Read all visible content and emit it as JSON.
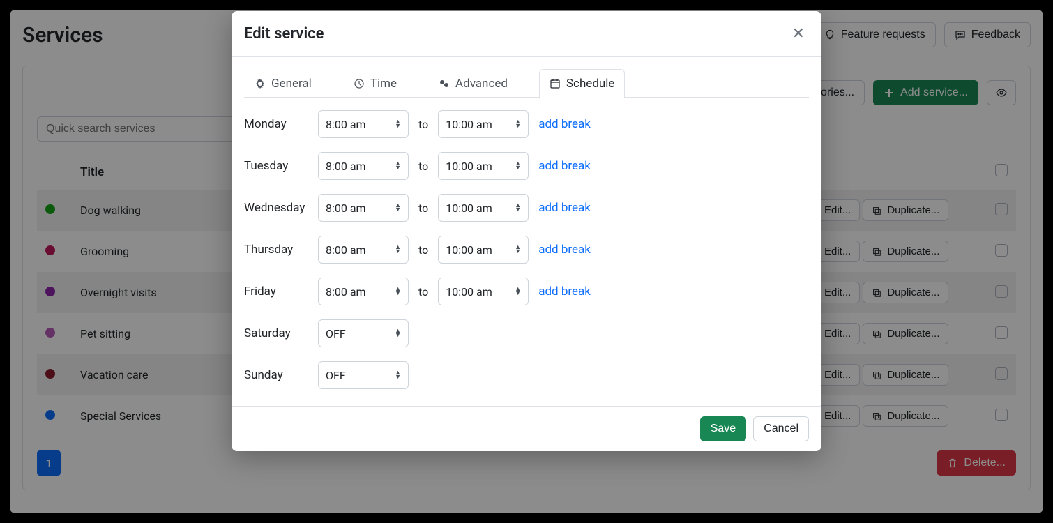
{
  "header": {
    "title": "Services",
    "feature_requests": "Feature requests",
    "feedback": "Feedback"
  },
  "toolbar": {
    "categories": "Categories...",
    "add_service": "Add service..."
  },
  "search": {
    "placeholder": "Quick search services"
  },
  "table": {
    "title_col": "Title",
    "edit": "Edit...",
    "duplicate": "Duplicate...",
    "rows": [
      {
        "title": "Dog walking",
        "color": "#14a314"
      },
      {
        "title": "Grooming",
        "color": "#c2185b"
      },
      {
        "title": "Overnight visits",
        "color": "#8e24aa"
      },
      {
        "title": "Pet sitting",
        "color": "#b95bb9"
      },
      {
        "title": "Vacation care",
        "color": "#8b1a2b"
      },
      {
        "title": "Special Services",
        "color": "#0d6efd"
      }
    ]
  },
  "footer": {
    "page": "1",
    "delete": "Delete..."
  },
  "modal": {
    "title": "Edit service",
    "tabs": {
      "general": "General",
      "time": "Time",
      "advanced": "Advanced",
      "schedule": "Schedule"
    },
    "to": "to",
    "add_break": "add break",
    "off": "OFF",
    "schedule": [
      {
        "day": "Monday",
        "from": "8:00 am",
        "until": "10:00 am"
      },
      {
        "day": "Tuesday",
        "from": "8:00 am",
        "until": "10:00 am"
      },
      {
        "day": "Wednesday",
        "from": "8:00 am",
        "until": "10:00 am"
      },
      {
        "day": "Thursday",
        "from": "8:00 am",
        "until": "10:00 am"
      },
      {
        "day": "Friday",
        "from": "8:00 am",
        "until": "10:00 am"
      },
      {
        "day": "Saturday",
        "off": true
      },
      {
        "day": "Sunday",
        "off": true
      }
    ],
    "save": "Save",
    "cancel": "Cancel"
  }
}
